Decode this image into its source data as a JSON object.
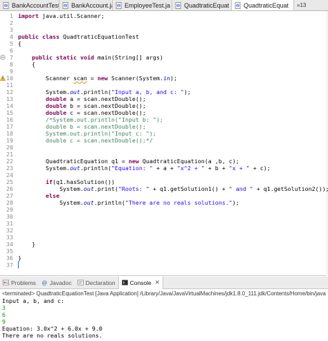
{
  "editor_tabs": [
    {
      "label": "BankAccountTest",
      "active": false
    },
    {
      "label": "BankAccount.jav",
      "active": false
    },
    {
      "label": "EmployeeTest.ja",
      "active": false
    },
    {
      "label": "QuadtraticEquat",
      "active": false
    },
    {
      "label": "QuadtraticEquat",
      "active": true
    }
  ],
  "tab_overflow_count": "»13",
  "code_lines": [
    {
      "n": "1",
      "text": "import java.util.Scanner;"
    },
    {
      "n": "2",
      "text": ""
    },
    {
      "n": "3",
      "text": ""
    },
    {
      "n": "4",
      "text": "public class QuadtraticEquationTest"
    },
    {
      "n": "5",
      "text": "{"
    },
    {
      "n": "6",
      "text": ""
    },
    {
      "n": "7",
      "text": "    public static void main(String[] args)"
    },
    {
      "n": "8",
      "text": "    {"
    },
    {
      "n": "9",
      "text": ""
    },
    {
      "n": "10",
      "text": "        Scanner scan = new Scanner(System.in);"
    },
    {
      "n": "11",
      "text": ""
    },
    {
      "n": "12",
      "text": "        System.out.println(\"Input a, b, and c: \");"
    },
    {
      "n": "13",
      "text": "        double a = scan.nextDouble();"
    },
    {
      "n": "14",
      "text": "        double b = scan.nextDouble();"
    },
    {
      "n": "15",
      "text": "        double c = scan.nextDouble();"
    },
    {
      "n": "16",
      "text": "        /*System.out.println(\"Input b: \");"
    },
    {
      "n": "17",
      "text": "        double b = scan.nextDouble();"
    },
    {
      "n": "18",
      "text": "        System.out.println(\"Input c: \");"
    },
    {
      "n": "19",
      "text": "        double c = scan.nextDouble();*/"
    },
    {
      "n": "20",
      "text": ""
    },
    {
      "n": "21",
      "text": ""
    },
    {
      "n": "22",
      "text": "        QuadtraticEquation q1 = new QuadtraticEquation(a ,b, c);"
    },
    {
      "n": "23",
      "text": "        System.out.println(\"Equation: \" + a + \"x^2 + \" + b + \"x + \" + c);"
    },
    {
      "n": "24",
      "text": ""
    },
    {
      "n": "25",
      "text": "        if(q1.hasSolution())"
    },
    {
      "n": "26",
      "text": "            System.out.print(\"Roots: \" + q1.getSolution1() + \" and \" + q1.getSolution2());"
    },
    {
      "n": "27",
      "text": "        else"
    },
    {
      "n": "28",
      "text": "            System.out.println(\"There are no reals solutions.\");"
    },
    {
      "n": "29",
      "text": ""
    },
    {
      "n": "30",
      "text": ""
    },
    {
      "n": "31",
      "text": ""
    },
    {
      "n": "32",
      "text": ""
    },
    {
      "n": "33",
      "text": ""
    },
    {
      "n": "34",
      "text": "    }"
    },
    {
      "n": "35",
      "text": ""
    },
    {
      "n": "36",
      "text": "}"
    },
    {
      "n": "37",
      "text": ""
    }
  ],
  "panel_tabs": [
    {
      "label": "Problems",
      "active": false,
      "icon": "problems-icon"
    },
    {
      "label": "Javadoc",
      "active": false,
      "icon": "javadoc-icon"
    },
    {
      "label": "Declaration",
      "active": false,
      "icon": "declaration-icon"
    },
    {
      "label": "Console",
      "active": true,
      "icon": "console-icon"
    }
  ],
  "console_lines": [
    {
      "text": "<terminated> QuadtraticEquationTest [Java Application] /Library/Java/JavaVirtualMachines/jdk1.8.0_111.jdk/Contents/Home/bin/java (Nov 2",
      "kind": "term"
    },
    {
      "text": "Input a, b, and c:",
      "kind": "out"
    },
    {
      "text": "3",
      "kind": "input"
    },
    {
      "text": "6",
      "kind": "input"
    },
    {
      "text": "9",
      "kind": "input"
    },
    {
      "text": "Equation: 3.0x^2 + 6.0x + 9.0",
      "kind": "out"
    },
    {
      "text": "There are no reals solutions.",
      "kind": "out"
    }
  ],
  "colors": {
    "keyword": "#7f0055",
    "string": "#2a00ff",
    "comment": "#3f7f5f",
    "field": "#0000c0",
    "console_input": "#119b00"
  }
}
